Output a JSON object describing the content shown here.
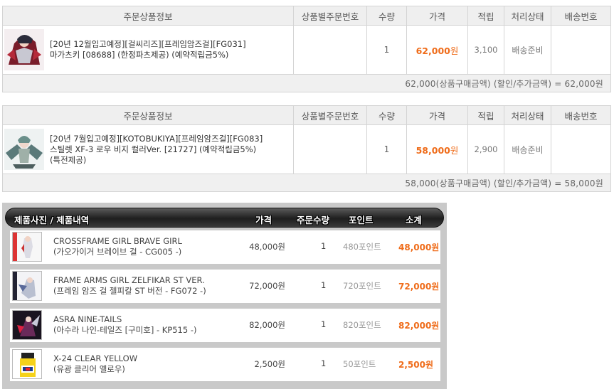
{
  "order_tables": [
    {
      "headers": {
        "product_info": "주문상품정보",
        "order_no": "상품별주문번호",
        "qty": "수량",
        "price": "가격",
        "points": "적립",
        "status": "처리상태",
        "delivery_no": "배송번호"
      },
      "item": {
        "thumb_icon": "figure-thumbnail-icon",
        "title_line1": "[20년 12월입고예정][걸씨리즈][프레임암즈걸][FG031]",
        "title_line2": "마가츠키 [08688] (한정파츠제공) (예약적립금5%)",
        "title_line3": "",
        "order_no": "",
        "qty": "1",
        "price_value": "62,000",
        "price_unit": "원",
        "points": "3,100",
        "status": "배송준비",
        "delivery_no": ""
      },
      "summary": "62,000(상품구매금액) (할인/추가금액) = 62,000원"
    },
    {
      "headers": {
        "product_info": "주문상품정보",
        "order_no": "상품별주문번호",
        "qty": "수량",
        "price": "가격",
        "points": "적립",
        "status": "처리상태",
        "delivery_no": "배송번호"
      },
      "item": {
        "thumb_icon": "figure-thumbnail-icon",
        "title_line1": "[20년 7월입고예정][KOTOBUKIYA][프레임암즈걸][FG083]",
        "title_line2": "스틸렛 XF-3 로우 비지 컬러Ver. [21727] (예약적립금5%)",
        "title_line3": "(특전제공)",
        "order_no": "",
        "qty": "1",
        "price_value": "58,000",
        "price_unit": "원",
        "points": "2,900",
        "status": "배송준비",
        "delivery_no": ""
      },
      "summary": "58,000(상품구매금액) (할인/추가금액) = 58,000원"
    }
  ],
  "cart": {
    "headers": {
      "product": "제품사진 / 제품내역",
      "price": "가격",
      "qty": "주문수량",
      "points": "포인트",
      "subtotal": "소계"
    },
    "items": [
      {
        "thumb_icon": "box-art-thumbnail-icon",
        "name_en": "CROSSFRAME GIRL BRAVE GIRL",
        "name_ko": "(가오가이거 브레이브 걸 - CG005 -)",
        "price": "48,000원",
        "qty": "1",
        "points": "480포인트",
        "subtotal": "48,000원"
      },
      {
        "thumb_icon": "box-art-thumbnail-icon",
        "name_en": "FRAME ARMS GIRL ZELFIKAR ST VER.",
        "name_ko": "(프레임 암즈 걸 젤피칼 ST 버전 - FG072 -)",
        "price": "72,000원",
        "qty": "1",
        "points": "720포인트",
        "subtotal": "72,000원"
      },
      {
        "thumb_icon": "box-art-thumbnail-icon",
        "name_en": "ASRA NINE-TAILS",
        "name_ko": "(아수라 나인-테일즈 [구미호] - KP515 -)",
        "price": "82,000원",
        "qty": "1",
        "points": "820포인트",
        "subtotal": "82,000원"
      },
      {
        "thumb_icon": "paint-bottle-thumbnail-icon",
        "name_en": "X-24 CLEAR YELLOW",
        "name_ko": "(유광 클리어 옐로우)",
        "price": "2,500원",
        "qty": "1",
        "points": "50포인트",
        "subtotal": "2,500원"
      }
    ]
  },
  "colors": {
    "accent_price": "#ef6c1a",
    "header_bg": "#efefef",
    "cart_bg": "#c9c9c9"
  }
}
